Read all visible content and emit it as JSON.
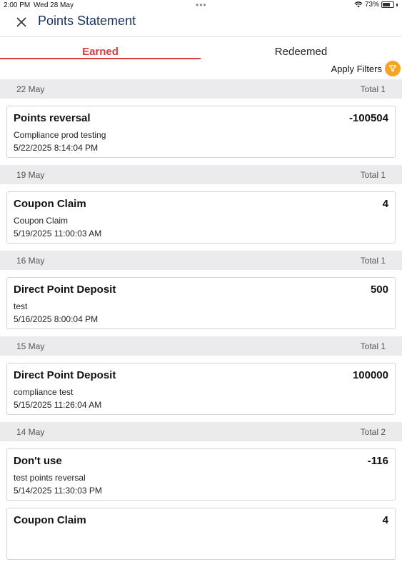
{
  "status": {
    "time": "2:00 PM",
    "date": "Wed 28 May",
    "battery": "73%",
    "battery_level": 0.73
  },
  "header": {
    "title": "Points Statement"
  },
  "tabs": [
    {
      "label": "Earned",
      "active": true
    },
    {
      "label": "Redeemed",
      "active": false
    }
  ],
  "filters": {
    "label": "Apply Filters"
  },
  "colors": {
    "accent": "#d63c3c",
    "title": "#17325e",
    "filter": "#f5a523"
  },
  "groups": [
    {
      "date": "22 May",
      "total": "Total 1",
      "items": [
        {
          "title": "Points reversal",
          "points": "-100504",
          "desc": "Compliance prod testing",
          "datetime": "5/22/2025 8:14:04 PM"
        }
      ]
    },
    {
      "date": "19 May",
      "total": "Total 1",
      "items": [
        {
          "title": "Coupon Claim",
          "points": "4",
          "desc": "Coupon Claim",
          "datetime": "5/19/2025 11:00:03 AM"
        }
      ]
    },
    {
      "date": "16 May",
      "total": "Total 1",
      "items": [
        {
          "title": "Direct Point Deposit",
          "points": "500",
          "desc": "test",
          "datetime": "5/16/2025 8:00:04 PM"
        }
      ]
    },
    {
      "date": "15 May",
      "total": "Total 1",
      "items": [
        {
          "title": "Direct Point Deposit",
          "points": "100000",
          "desc": "compliance test",
          "datetime": "5/15/2025 11:26:04 AM"
        }
      ]
    },
    {
      "date": "14 May",
      "total": "Total 2",
      "items": [
        {
          "title": "Don't use",
          "points": "-116",
          "desc": "test points reversal",
          "datetime": "5/14/2025 11:30:03 PM"
        },
        {
          "title": "Coupon Claim",
          "points": "4",
          "desc": "",
          "datetime": ""
        }
      ]
    }
  ]
}
